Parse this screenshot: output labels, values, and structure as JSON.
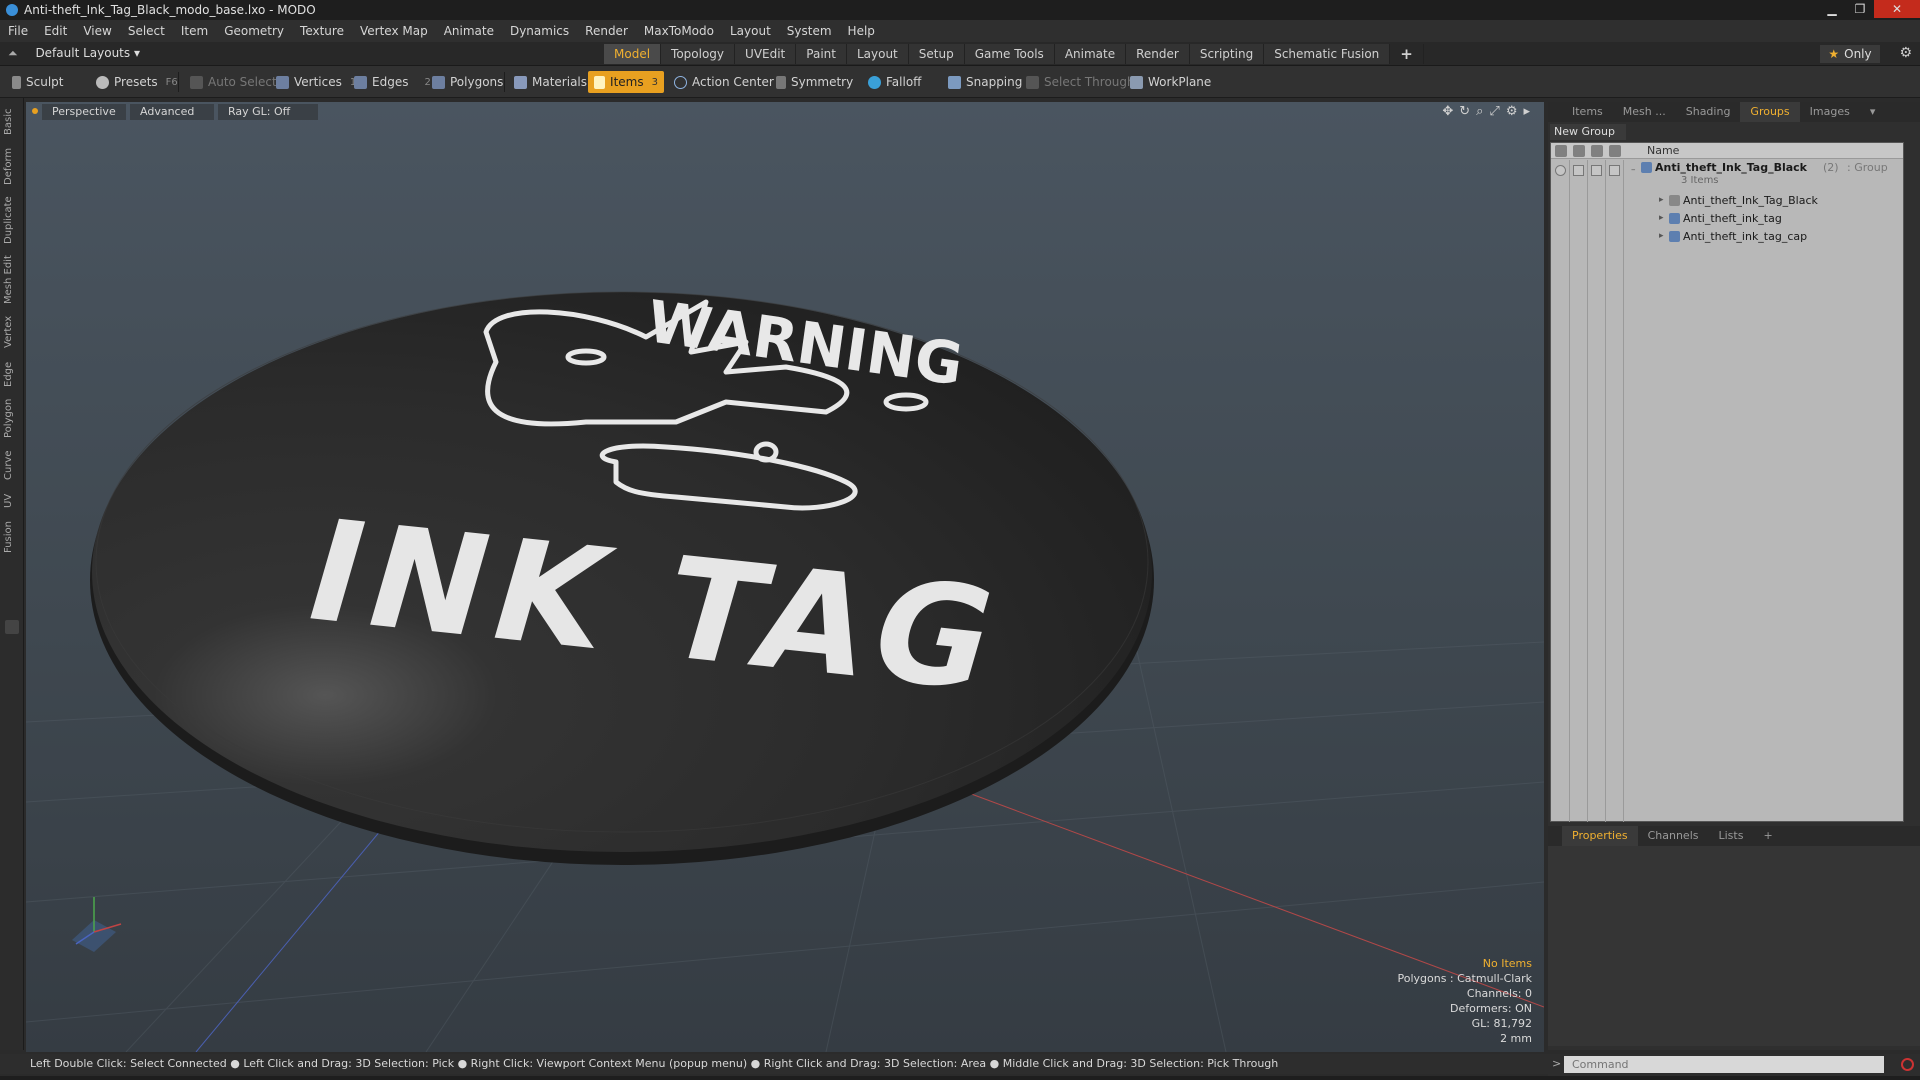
{
  "window": {
    "title": "Anti-theft_Ink_Tag_Black_modo_base.lxo - MODO",
    "controls": {
      "minimize": "▁",
      "restore": "❐",
      "close": "✕"
    }
  },
  "menu": [
    "File",
    "Edit",
    "View",
    "Select",
    "Item",
    "Geometry",
    "Texture",
    "Vertex Map",
    "Animate",
    "Dynamics",
    "Render",
    "MaxToModo",
    "Layout",
    "System",
    "Help"
  ],
  "layouts": {
    "selector": "Default Layouts",
    "only": "Only"
  },
  "mode_tabs": [
    "Model",
    "Topology",
    "UVEdit",
    "Paint",
    "Layout",
    "Setup",
    "Game Tools",
    "Animate",
    "Render",
    "Scripting",
    "Schematic Fusion"
  ],
  "mode_tab_active": "Model",
  "toolbar": {
    "sculpt": "Sculpt",
    "presets": "Presets",
    "presets_key": "F6",
    "auto_select": "Auto Select",
    "vertices": "Vertices",
    "vertices_count": "1",
    "edges": "Edges",
    "edges_count": "2",
    "polygons": "Polygons",
    "materials": "Materials",
    "items": "Items",
    "items_count": "3",
    "action_center": "Action Center",
    "symmetry": "Symmetry",
    "falloff": "Falloff",
    "snapping": "Snapping",
    "select_through": "Select Through",
    "workplane": "WorkPlane"
  },
  "left_tabs": [
    "Basic",
    "Deform",
    "Duplicate",
    "Mesh Edit",
    "Vertex",
    "Edge",
    "Polygon",
    "Curve",
    "UV",
    "Fusion"
  ],
  "viewport": {
    "view": "Perspective",
    "shading": "Advanced",
    "raygl": "Ray GL: Off",
    "model_text_top": "WARNING",
    "model_text_main": "INK TAG",
    "info": {
      "selection": "No Items",
      "polygons": "Polygons : Catmull-Clark",
      "channels": "Channels: 0",
      "deformers": "Deformers: ON",
      "gl": "GL: 81,792",
      "scale": "2 mm"
    }
  },
  "right_tabs": [
    "Items",
    "Mesh ...",
    "Shading",
    "Groups",
    "Images"
  ],
  "right_tab_active": "Groups",
  "groups": {
    "new_group": "New Group",
    "col_name": "Name",
    "root": {
      "name": "Anti_theft_Ink_Tag_Black",
      "count": "(2)",
      "type": ": Group",
      "sub": "3 Items"
    },
    "children": [
      "Anti_theft_Ink_Tag_Black",
      "Anti_theft_ink_tag",
      "Anti_theft_ink_tag_cap"
    ]
  },
  "prop_tabs": [
    "Properties",
    "Channels",
    "Lists"
  ],
  "prop_tab_active": "Properties",
  "status": "Left Double Click: Select Connected ● Left Click and Drag: 3D Selection: Pick ● Right Click: Viewport Context Menu (popup menu) ● Right Click and Drag: 3D Selection: Area ● Middle Click and Drag: 3D Selection: Pick Through",
  "command": {
    "placeholder": "Command"
  },
  "colors": {
    "accent": "#f0b030",
    "viewport_bg": "#434c55",
    "model": "#2a2a2a"
  }
}
